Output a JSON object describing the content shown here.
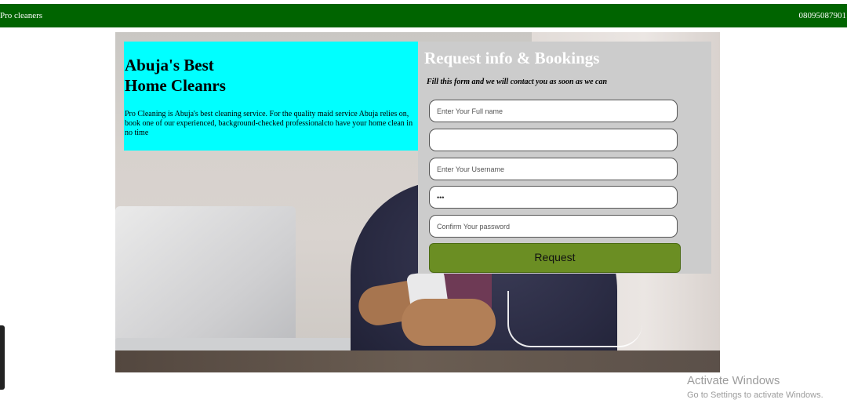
{
  "nav": {
    "brand": "Pro cleaners",
    "phone": "08095087901",
    "bg_color": "#006400"
  },
  "hero": {
    "heading": "Abuja's Best\nHome Cleanrs",
    "description": "Pro Cleaning is Abuja's best cleaning service. For the quality maid service Abuja relies on, book one of our experienced, background-checked professionalcto have your home clean in no time",
    "panel_color": "#00ffff"
  },
  "form": {
    "title": "Request info & Bookings",
    "subtitle": "Fill this form and we will contact you as soon as we can",
    "fields": [
      {
        "placeholder": "Enter Your Full name",
        "value": ""
      },
      {
        "placeholder": "",
        "value": ""
      },
      {
        "placeholder": "Enter Your Username",
        "value": ""
      },
      {
        "placeholder": "",
        "value": "•••"
      },
      {
        "placeholder": "Confirm Your password",
        "value": ""
      }
    ],
    "submit_label": "Request",
    "button_color": "#6b8e23"
  },
  "os_watermark": {
    "line1": "Activate Windows",
    "line2": "Go to Settings to activate Windows."
  }
}
